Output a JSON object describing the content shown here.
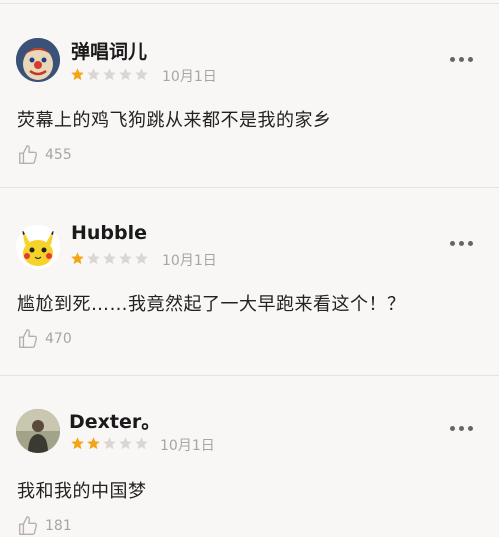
{
  "colors": {
    "background": "#f9f7f6",
    "star_filled": "#f2a516",
    "star_empty": "#dad6d4",
    "meta_text": "#a8a4a2"
  },
  "comments": [
    {
      "username": "弹唱词儿",
      "rating": 1,
      "max_rating": 5,
      "date": "10月1日",
      "text": "荧幕上的鸡飞狗跳从来都不是我的家乡",
      "likes": "455",
      "avatar_icon": "clown-avatar-icon"
    },
    {
      "username": "Hubble",
      "rating": 1,
      "max_rating": 5,
      "date": "10月1日",
      "text": "尴尬到死……我竟然起了一大早跑来看这个！？",
      "likes": "470",
      "avatar_icon": "pikachu-avatar-icon"
    },
    {
      "username": "Dexter。",
      "rating": 2,
      "max_rating": 5,
      "date": "10月1日",
      "text": "我和我的中国梦",
      "likes": "181",
      "avatar_icon": "person-photo-avatar-icon"
    }
  ]
}
